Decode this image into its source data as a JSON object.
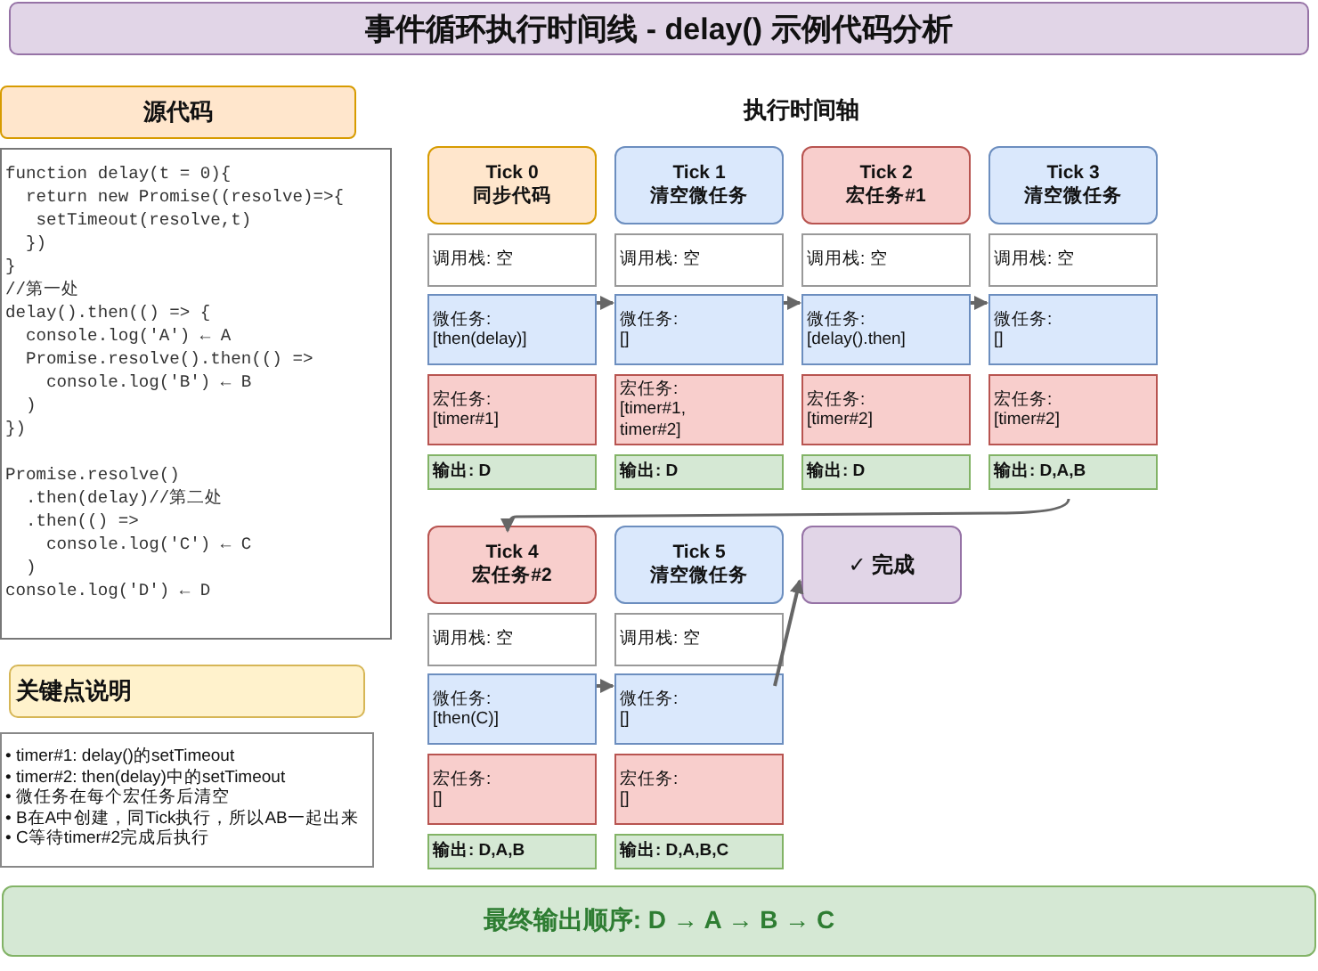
{
  "title": "事件循环执行时间线 - delay() 示例代码分析",
  "source": {
    "heading": "源代码",
    "blocks": [
      [
        "function delay(t = 0){",
        "  return new Promise((resolve)=>{",
        "   setTimeout(resolve,t)",
        "  })",
        "}",
        "//第一处",
        "delay().then(() => {",
        "  console.log('A') ← A",
        "  Promise.resolve().then(() =>",
        "    console.log('B') ← B",
        "  )",
        "})"
      ],
      [
        "Promise.resolve()",
        "  .then(delay)//第二处",
        "  .then(() =>",
        "    console.log('C') ← C",
        "  )",
        "console.log('D') ← D"
      ]
    ]
  },
  "notes": {
    "heading": "关键点说明",
    "items": [
      "• timer#1: delay()的setTimeout",
      "• timer#2: then(delay)中的setTimeout",
      "• 微任务在每个宏任务后清空",
      "• B在A中创建，同Tick执行，所以AB一起出来",
      "• C等待timer#2完成后执行"
    ]
  },
  "timeline": {
    "heading": "执行时间轴",
    "rows": [
      [
        {
          "kind": "sync",
          "header": "Tick 0\n同步代码",
          "stack": "调用栈: 空",
          "micro": "微任务:\n[then(delay)]",
          "macro": "宏任务:\n[timer#1]",
          "output": "输出: D"
        },
        {
          "kind": "micro",
          "header": "Tick 1\n清空微任务",
          "stack": "调用栈: 空",
          "micro": "微任务:\n[]",
          "macro": "宏任务:\n[timer#1,\ntimer#2]",
          "output": "输出: D"
        },
        {
          "kind": "macro",
          "header": "Tick 2\n宏任务#1",
          "stack": "调用栈: 空",
          "micro": "微任务:\n[delay().then]",
          "macro": "宏任务:\n[timer#2]",
          "output": "输出: D"
        },
        {
          "kind": "micro",
          "header": "Tick 3\n清空微任务",
          "stack": "调用栈: 空",
          "micro": "微任务:\n[]",
          "macro": "宏任务:\n[timer#2]",
          "output": "输出: D,A,B"
        }
      ],
      [
        {
          "kind": "macro",
          "header": "Tick 4\n宏任务#2",
          "stack": "调用栈: 空",
          "micro": "微任务:\n[then(C)]",
          "macro": "宏任务:\n[]",
          "output": "输出: D,A,B"
        },
        {
          "kind": "micro",
          "header": "Tick 5\n清空微任务",
          "stack": "调用栈: 空",
          "micro": "微任务:\n[]",
          "macro": "宏任务:\n[]",
          "output": "输出: D,A,B,C"
        },
        {
          "kind": "done",
          "header": "✓ 完成"
        }
      ]
    ]
  },
  "result": "最终输出顺序: D → A → B → C"
}
